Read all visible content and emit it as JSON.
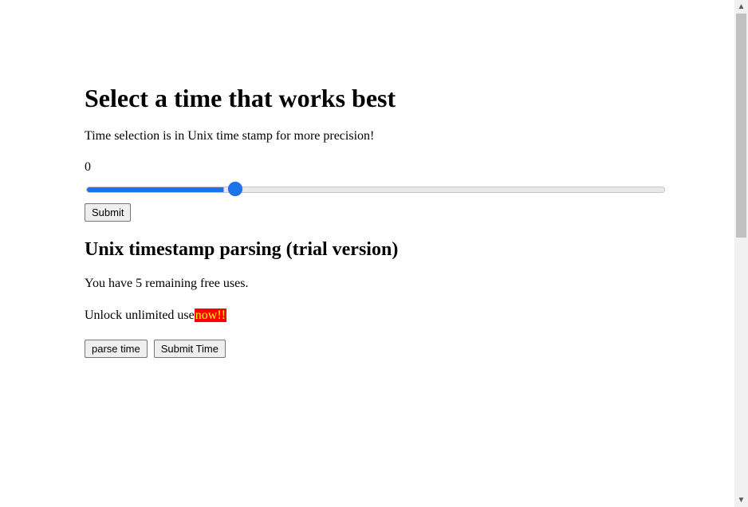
{
  "heading": "Select a time that works best",
  "intro": "Time selection is in Unix time stamp for more precision!",
  "slider": {
    "value_label": "0",
    "min": "-1000000000",
    "max": "3000000000",
    "value": "0"
  },
  "submit_label": "Submit",
  "parser": {
    "heading": "Unix timestamp parsing (trial version)",
    "remaining_text": "You have 5 remaining free uses.",
    "unlock_prefix": "Unlock unlimited use",
    "unlock_badge": "now!!",
    "parse_button": "parse time",
    "submit_time_button": "Submit Time"
  }
}
